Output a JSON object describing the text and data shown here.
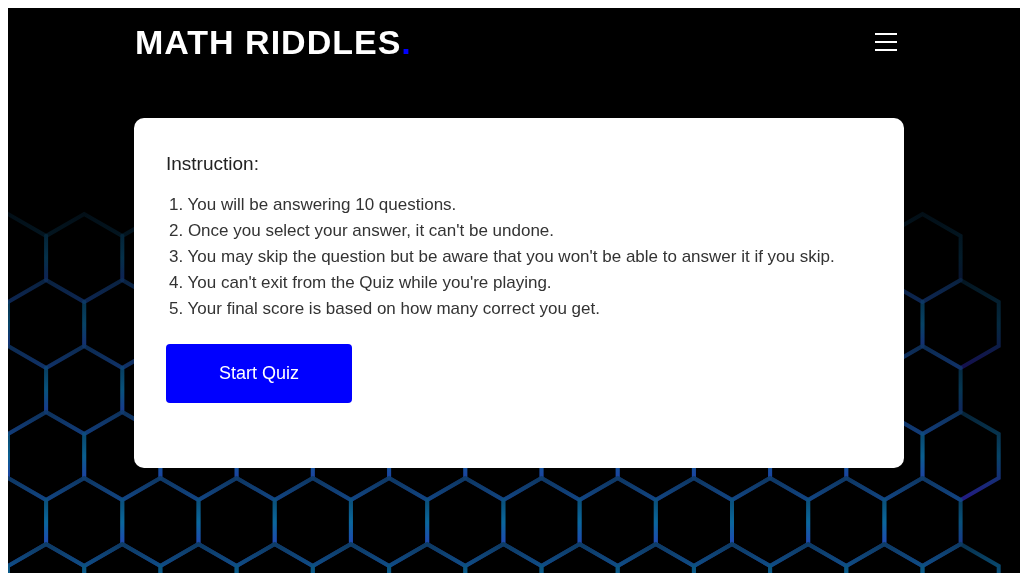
{
  "header": {
    "logo": "MATH RIDDLES",
    "logo_mark": "."
  },
  "card": {
    "title": "Instruction:",
    "items": [
      "1. You will be answering 10 questions.",
      "2. Once you select your answer, it can't be undone.",
      "3. You may skip the question but be aware that you won't be able to answer it if you skip.",
      "4. You can't exit from the Quiz while you're playing.",
      "5. Your final score is based on how many correct you get."
    ],
    "button": "Start Quiz"
  }
}
